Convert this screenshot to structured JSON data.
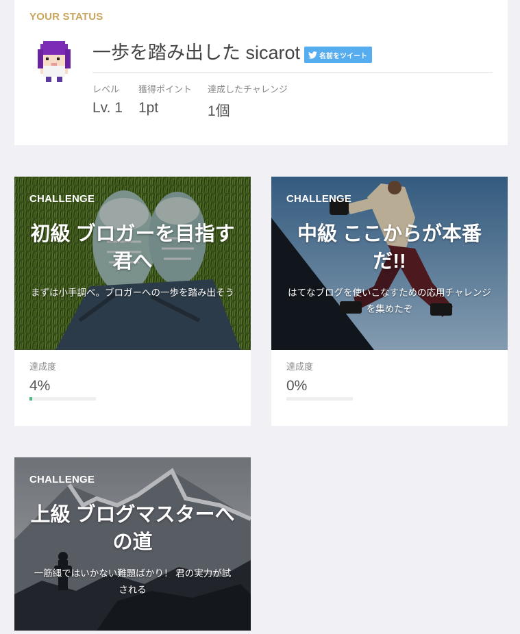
{
  "status": {
    "heading": "YOUR STATUS",
    "user_title": "一歩を踏み出した sicarot",
    "tweet_label": "名前をツイート",
    "stats": [
      {
        "label": "レベル",
        "value": "Lv. 1"
      },
      {
        "label": "獲得ポイント",
        "value": "1pt"
      },
      {
        "label": "達成したチャレンジ",
        "value": "1個"
      }
    ]
  },
  "challenges": [
    {
      "tag": "CHALLENGE",
      "title": "初級 ブロガーを目指す君へ",
      "description": "まずは小手調べ。ブロガーへの一歩を踏み出そう",
      "progress_label": "達成度",
      "progress_text": "4%",
      "progress": 0.04
    },
    {
      "tag": "CHALLENGE",
      "title": "中級 ここからが本番だ!!",
      "description": "はてなブログを使いこなすための応用チャレンジを集めたぞ",
      "progress_label": "達成度",
      "progress_text": "0%",
      "progress": 0.0
    },
    {
      "tag": "CHALLENGE",
      "title": "上級 ブログマスターへの道",
      "description": "一筋縄ではいかない難題ばかり！ 君の実力が試される"
    }
  ],
  "colors": {
    "accent_gold": "#c9a45c",
    "twitter_blue": "#55acee",
    "progress_green": "#4cb988",
    "page_bg": "#f0f0f5"
  }
}
